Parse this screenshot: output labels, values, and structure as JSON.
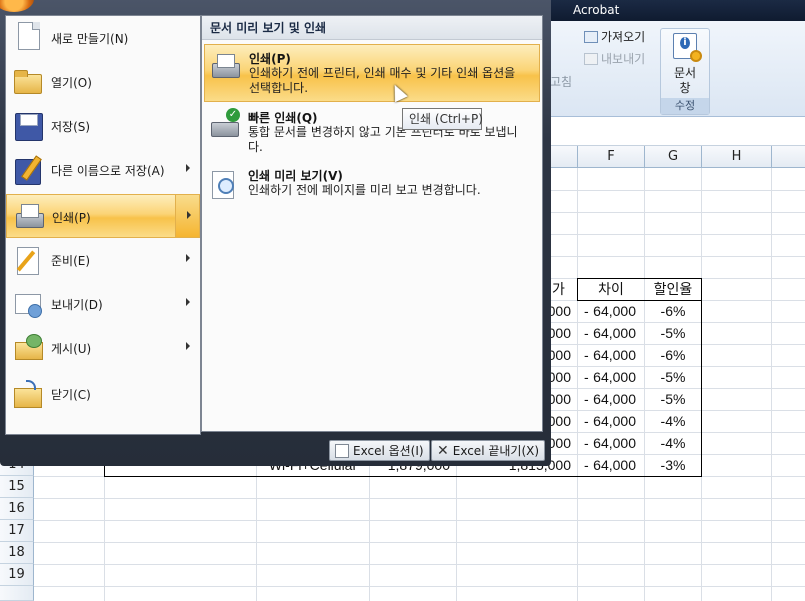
{
  "app": {
    "ribbon_tab": "Acrobat"
  },
  "ribbon": {
    "import_label": "가져오기",
    "export_label": "내보내기",
    "edit_fragment": "고침",
    "docwin_label_1": "문서",
    "docwin_label_2": "창",
    "group_label": "수정"
  },
  "grid": {
    "columns": [
      "F",
      "G",
      "H"
    ],
    "rows": [
      "14",
      "15",
      "16",
      "17",
      "18",
      "19"
    ],
    "table_headers": {
      "e_tail": "가",
      "diff": "차이",
      "rate": "할인율"
    },
    "row14": {
      "c": "Wi-Fi+Cellular",
      "d": "1,879,000",
      "e": "1,815,000"
    },
    "table_rows": [
      {
        "e": ",000",
        "sign": "-",
        "diff": "64,000",
        "rate": "-6%"
      },
      {
        "e": ",000",
        "sign": "-",
        "diff": "64,000",
        "rate": "-5%"
      },
      {
        "e": ",000",
        "sign": "-",
        "diff": "64,000",
        "rate": "-6%"
      },
      {
        "e": ",000",
        "sign": "-",
        "diff": "64,000",
        "rate": "-5%"
      },
      {
        "e": ",000",
        "sign": "-",
        "diff": "64,000",
        "rate": "-5%"
      },
      {
        "e": ",000",
        "sign": "-",
        "diff": "64,000",
        "rate": "-4%"
      },
      {
        "e": ",000",
        "sign": "-",
        "diff": "64,000",
        "rate": "-4%"
      },
      {
        "e": ",000",
        "sign": "-",
        "diff": "64,000",
        "rate": "-3%"
      }
    ]
  },
  "office_menu": {
    "items": [
      {
        "label": "새로 만들기(N)"
      },
      {
        "label": "열기(O)"
      },
      {
        "label": "저장(S)"
      },
      {
        "label": "다른 이름으로 저장(A)"
      },
      {
        "label": "인쇄(P)"
      },
      {
        "label": "준비(E)"
      },
      {
        "label": "보내기(D)"
      },
      {
        "label": "게시(U)"
      },
      {
        "label": "닫기(C)"
      }
    ],
    "submenu": {
      "title": "문서 미리 보기 및 인쇄",
      "items": [
        {
          "title": "인쇄(P)",
          "desc": "인쇄하기 전에 프린터, 인쇄 매수 및 기타 인쇄 옵션을 선택합니다."
        },
        {
          "title": "빠른 인쇄(Q)",
          "desc": "통합 문서를 변경하지 않고 기본 프린터로 바로 보냅니다."
        },
        {
          "title": "인쇄 미리 보기(V)",
          "desc": "인쇄하기 전에 페이지를 미리 보고 변경합니다."
        }
      ]
    },
    "tooltip": "인쇄 (Ctrl+P)",
    "options_button": "Excel 옵션(I)",
    "exit_button": "Excel 끝내기(X)"
  }
}
